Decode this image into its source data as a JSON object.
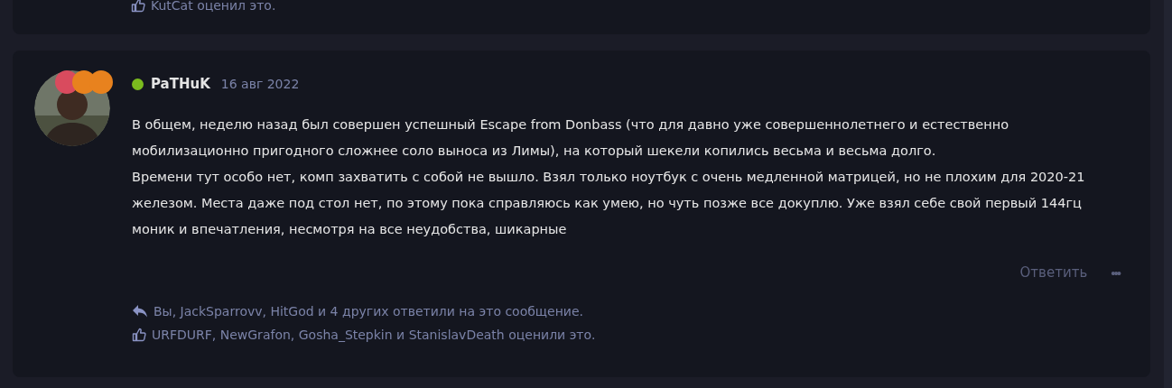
{
  "previous_post": {
    "reactions": "KutCat оценил это."
  },
  "post": {
    "author": {
      "name": "PaTHuK",
      "online": true
    },
    "badges": [
      {
        "color": "#d94b5e"
      },
      {
        "color": "#e8821e"
      },
      {
        "color": "#e8821e"
      }
    ],
    "date": "16 авг 2022",
    "paragraphs": [
      "В общем, неделю назад был совершен успешный Escape from Donbass (что для давно уже совершеннолетнего и естественно мобилизационно пригодного сложнее соло выноса из Лимы), на который шекели копились весьма и весьма долго.",
      "Времени тут особо нет, комп захватить с собой не вышло. Взял только ноутбук с очень медленной матрицей, но не плохим для 2020-21 железом. Места даже под стол нет, по этому пока справляюсь как умею, но чуть позже все докуплю. Уже взял себе свой первый 144гц моник и впечатления, несмотря на все неудобства, шикарные"
    ],
    "reply_button": "Ответить",
    "more_button": "•••",
    "replies": "Вы, JackSparrovv, HitGod и 4 других ответили на это сообщение.",
    "reactions": "URFDURF, NewGrafon, Gosha_Stepkin и StanislavDeath оценили это."
  }
}
